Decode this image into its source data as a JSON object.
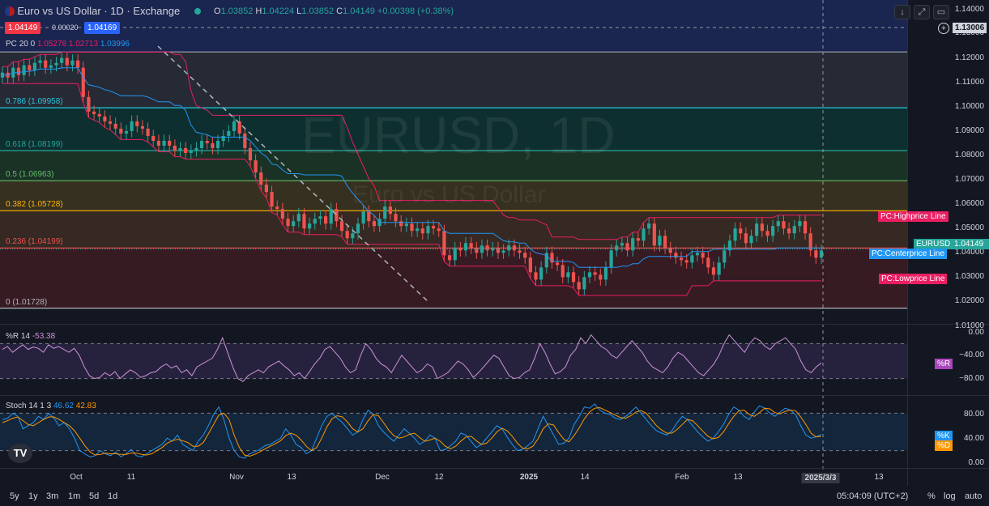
{
  "header": {
    "title": "Euro vs US Dollar · 1D · Exchange",
    "open_label": "O",
    "open": "1.03852",
    "high_label": "H",
    "high": "1.04224",
    "low_label": "L",
    "low": "1.03852",
    "close_label": "C",
    "close": "1.04149",
    "change": "+0.00398 (+0.38%)",
    "sell_price": "1.04149",
    "spread": "0.00020",
    "buy_price": "1.04169",
    "pc_label": "PC",
    "pc_params": "20 0",
    "pc_values": [
      "1.05278",
      "1.02713",
      "1.03996"
    ],
    "watermark_symbol": "EURUSD, 1D",
    "watermark_name": "Euro vs US Dollar"
  },
  "colors": {
    "background": "#131722",
    "up": "#26a69a",
    "down": "#ef5350",
    "pc_high": "#e91e63",
    "pc_center": "#2196f3",
    "pc_low": "#e91e63",
    "williams": "#ce93d8",
    "stoch_k": "#2196f3",
    "stoch_d": "#ff9800"
  },
  "price_axis": [
    "1.14000",
    "1.13006",
    "1.12000",
    "1.11000",
    "1.10000",
    "1.09000",
    "1.08000",
    "1.07000",
    "1.06000",
    "1.05000",
    "1.04000",
    "1.03000",
    "1.02000",
    "1.01000"
  ],
  "crosshair_price": "1.13006",
  "last_price_tag": {
    "symbol": "EURUSD",
    "price": "1.04149"
  },
  "indicator_tags": {
    "high": "PC:Highprice Line",
    "center": "PC:Centerprice Line",
    "low": "PC:Lowprice Line"
  },
  "fib_levels": [
    {
      "label": "0.786 (1.09958)",
      "price": 1.09958,
      "color": "#26c6da"
    },
    {
      "label": "0.618 (1.08199)",
      "price": 1.08199,
      "color": "#26a69a"
    },
    {
      "label": "0.5 (1.06963)",
      "price": 1.06963,
      "color": "#66bb6a"
    },
    {
      "label": "0.382 (1.05728)",
      "price": 1.05728,
      "color": "#ffb300"
    },
    {
      "label": "0.236 (1.04199)",
      "price": 1.04199,
      "color": "#ef5350"
    },
    {
      "label": "0 (1.01728)",
      "price": 1.01728,
      "color": "#b2b5be"
    }
  ],
  "fib_top_price": 1.1225,
  "williams": {
    "label": "%R",
    "param": "14",
    "value": "-53.38",
    "axis": [
      "0.00",
      "−40.00",
      "−80.00"
    ],
    "tag": "%R",
    "values": [
      -30,
      -25,
      -35,
      -28,
      -22,
      -30,
      -26,
      -28,
      -35,
      -22,
      -28,
      -25,
      -30,
      -35,
      -28,
      -40,
      -60,
      -75,
      -80,
      -78,
      -70,
      -75,
      -68,
      -80,
      -72,
      -65,
      -70,
      -78,
      -75,
      -70,
      -68,
      -60,
      -55,
      -62,
      -58,
      -70,
      -65,
      -75,
      -60,
      -55,
      -50,
      -45,
      -30,
      -10,
      -35,
      -60,
      -80,
      -85,
      -75,
      -70,
      -65,
      -70,
      -60,
      -55,
      -50,
      -58,
      -65,
      -75,
      -70,
      -80,
      -68,
      -55,
      -45,
      -30,
      -25,
      -35,
      -45,
      -60,
      -70,
      -65,
      -40,
      -20,
      -30,
      -45,
      -55,
      -60,
      -70,
      -55,
      -40,
      -50,
      -60,
      -70,
      -65,
      -55,
      -60,
      -80,
      -75,
      -70,
      -60,
      -50,
      -55,
      -65,
      -78,
      -70,
      -60,
      -50,
      -40,
      -45,
      -60,
      -75,
      -80,
      -78,
      -70,
      -65,
      -45,
      -20,
      -35,
      -55,
      -72,
      -68,
      -60,
      -40,
      -30,
      -10,
      -20,
      -5,
      -15,
      -25,
      -30,
      -40,
      -45,
      -35,
      -25,
      -15,
      -25,
      -35,
      -50,
      -60,
      -65,
      -70,
      -60,
      -45,
      -35,
      -40,
      -50,
      -60,
      -70,
      -75,
      -65,
      -55,
      -40,
      -20,
      -5,
      -15,
      -25,
      -35,
      -20,
      -10,
      -15,
      -25,
      -30,
      -20,
      -15,
      -10,
      -20,
      -30,
      -50,
      -65,
      -70,
      -60,
      -53
    ]
  },
  "stochastic": {
    "label": "Stoch",
    "params": "14 1 3",
    "k_value": "46.62",
    "d_value": "42.83",
    "axis": [
      "80.00",
      "40.00",
      "0.00"
    ],
    "k_tag": "%K",
    "d_tag": "%D",
    "k": [
      70,
      72,
      80,
      75,
      55,
      60,
      65,
      75,
      70,
      80,
      72,
      60,
      65,
      55,
      40,
      20,
      15,
      10,
      12,
      20,
      15,
      12,
      18,
      10,
      15,
      22,
      12,
      10,
      15,
      20,
      25,
      30,
      40,
      35,
      45,
      30,
      25,
      20,
      35,
      45,
      60,
      78,
      90,
      70,
      40,
      20,
      10,
      8,
      15,
      18,
      22,
      28,
      30,
      35,
      40,
      55,
      45,
      30,
      25,
      15,
      20,
      40,
      60,
      75,
      80,
      72,
      65,
      55,
      45,
      50,
      70,
      85,
      78,
      60,
      50,
      42,
      35,
      45,
      55,
      48,
      40,
      30,
      35,
      45,
      40,
      20,
      22,
      28,
      35,
      48,
      45,
      35,
      25,
      30,
      40,
      50,
      60,
      55,
      42,
      30,
      20,
      22,
      28,
      35,
      55,
      75,
      60,
      45,
      30,
      32,
      40,
      62,
      75,
      90,
      88,
      95,
      85,
      80,
      78,
      72,
      70,
      75,
      82,
      90,
      80,
      70,
      60,
      52,
      48,
      45,
      52,
      65,
      75,
      70,
      60,
      50,
      42,
      35,
      40,
      50,
      62,
      78,
      90,
      85,
      75,
      70,
      82,
      92,
      88,
      80,
      75,
      82,
      88,
      85,
      78,
      60,
      45,
      40,
      42,
      46
    ],
    "d": [
      65,
      68,
      72,
      74,
      68,
      62,
      60,
      65,
      70,
      74,
      74,
      70,
      65,
      60,
      52,
      40,
      28,
      18,
      13,
      14,
      16,
      15,
      15,
      14,
      14,
      16,
      16,
      14,
      13,
      15,
      20,
      25,
      32,
      36,
      38,
      36,
      33,
      27,
      27,
      33,
      47,
      62,
      77,
      80,
      70,
      45,
      25,
      13,
      11,
      14,
      18,
      23,
      27,
      31,
      36,
      44,
      48,
      45,
      37,
      27,
      20,
      25,
      40,
      58,
      71,
      76,
      74,
      66,
      55,
      50,
      55,
      68,
      78,
      76,
      65,
      53,
      44,
      40,
      42,
      46,
      48,
      41,
      35,
      37,
      40,
      35,
      27,
      23,
      27,
      35,
      42,
      43,
      36,
      30,
      32,
      40,
      50,
      56,
      52,
      43,
      32,
      24,
      23,
      27,
      39,
      55,
      63,
      61,
      49,
      38,
      34,
      44,
      57,
      71,
      82,
      88,
      89,
      85,
      81,
      77,
      73,
      72,
      76,
      82,
      84,
      80,
      70,
      60,
      53,
      48,
      48,
      54,
      62,
      70,
      68,
      60,
      51,
      43,
      39,
      41,
      50,
      63,
      75,
      84,
      85,
      78,
      75,
      81,
      88,
      87,
      81,
      79,
      83,
      85,
      84,
      74,
      62,
      48,
      42,
      43
    ]
  },
  "x_axis": [
    "Oct",
    "11",
    "Nov",
    "13",
    "Dec",
    "12",
    "2025",
    "14",
    "Feb",
    "13",
    "2025/3/3",
    "13"
  ],
  "timeframes": [
    "5y",
    "1y",
    "3m",
    "1m",
    "5d",
    "1d"
  ],
  "footer": {
    "time": "05:04:09 (UTC+2)",
    "percent": "%",
    "log": "log",
    "auto": "auto"
  },
  "chart_data": {
    "type": "candlestick",
    "title": "Euro vs US Dollar · 1D · Exchange",
    "y_range": [
      1.0125,
      1.1425
    ],
    "closes": [
      1.114,
      1.112,
      1.116,
      1.113,
      1.117,
      1.115,
      1.118,
      1.119,
      1.116,
      1.117,
      1.118,
      1.12,
      1.117,
      1.119,
      1.116,
      1.104,
      1.098,
      1.097,
      1.096,
      1.094,
      1.093,
      1.091,
      1.089,
      1.09,
      1.094,
      1.092,
      1.091,
      1.088,
      1.086,
      1.084,
      1.086,
      1.084,
      1.082,
      1.083,
      1.081,
      1.082,
      1.083,
      1.086,
      1.085,
      1.083,
      1.086,
      1.088,
      1.09,
      1.094,
      1.089,
      1.083,
      1.078,
      1.073,
      1.068,
      1.065,
      1.059,
      1.058,
      1.054,
      1.051,
      1.053,
      1.056,
      1.05,
      1.052,
      1.054,
      1.055,
      1.052,
      1.058,
      1.053,
      1.049,
      1.046,
      1.048,
      1.052,
      1.057,
      1.053,
      1.051,
      1.054,
      1.059,
      1.056,
      1.053,
      1.051,
      1.052,
      1.049,
      1.05,
      1.048,
      1.051,
      1.05,
      1.049,
      1.039,
      1.037,
      1.042,
      1.041,
      1.044,
      1.042,
      1.04,
      1.043,
      1.041,
      1.042,
      1.04,
      1.041,
      1.043,
      1.041,
      1.04,
      1.038,
      1.032,
      1.029,
      1.034,
      1.04,
      1.036,
      1.035,
      1.03,
      1.032,
      1.028,
      1.025,
      1.03,
      1.032,
      1.031,
      1.029,
      1.034,
      1.041,
      1.043,
      1.044,
      1.041,
      1.046,
      1.045,
      1.05,
      1.052,
      1.043,
      1.047,
      1.042,
      1.04,
      1.038,
      1.037,
      1.036,
      1.039,
      1.04,
      1.038,
      1.034,
      1.031,
      1.036,
      1.041,
      1.045,
      1.05,
      1.048,
      1.044,
      1.047,
      1.052,
      1.049,
      1.047,
      1.051,
      1.053,
      1.05,
      1.048,
      1.051,
      1.053,
      1.048,
      1.041,
      1.038,
      1.041
    ]
  }
}
